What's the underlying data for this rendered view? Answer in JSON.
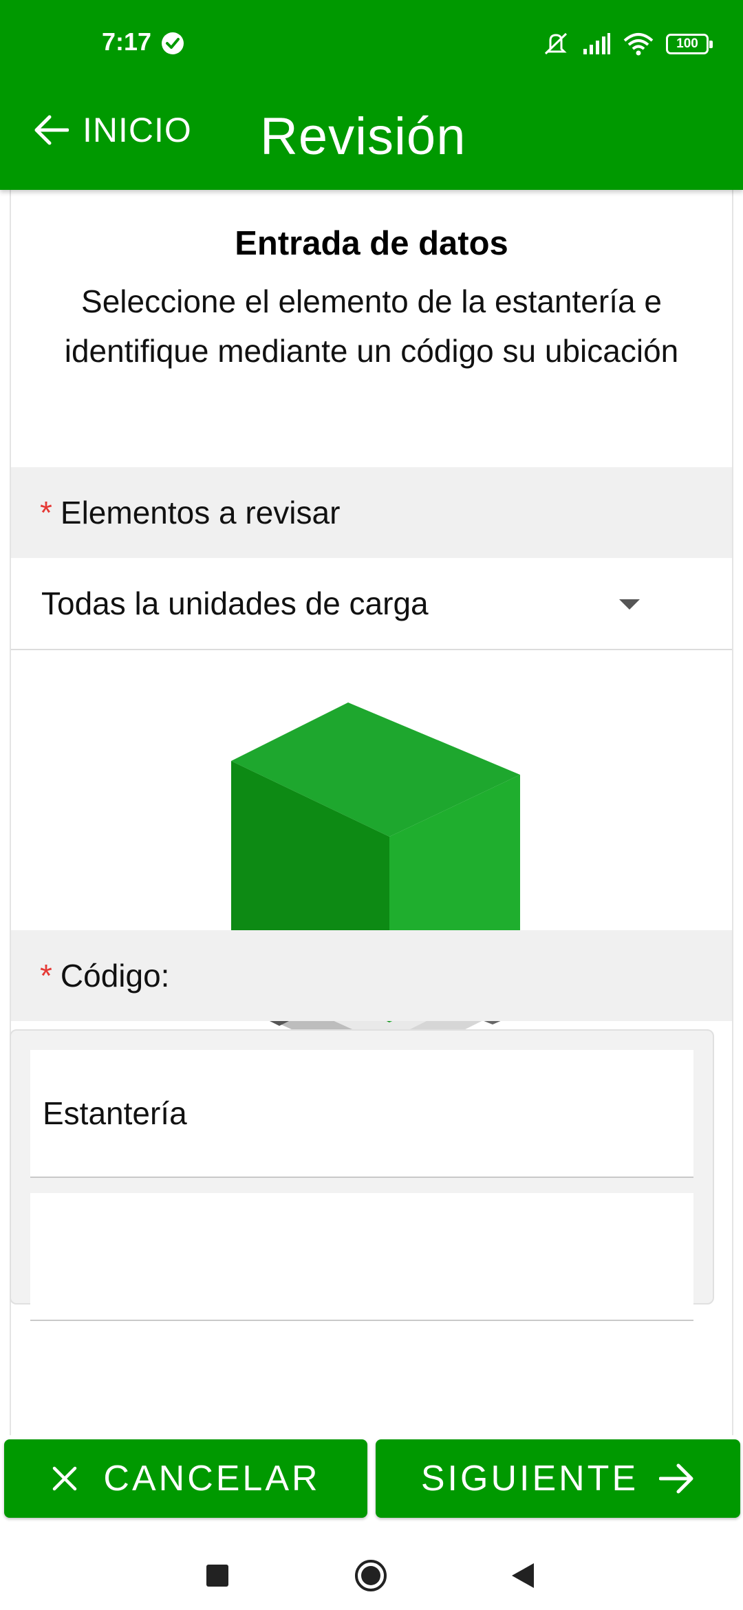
{
  "status_bar": {
    "time": "7:17",
    "battery": "100",
    "icons": [
      "check-circle-icon",
      "vibrate-off-icon",
      "signal-icon",
      "wifi-icon",
      "battery-icon"
    ]
  },
  "app_bar": {
    "back_label": "INICIO",
    "title": "Revisión",
    "color": "#009900"
  },
  "form": {
    "heading": "Entrada de datos",
    "description": "Seleccione el elemento de la estantería e identifique mediante un código su ubicación",
    "required_marker": "*",
    "elements_label": "Elementos a revisar",
    "elements_selected": "Todas la unidades de carga",
    "code_label": "Código:",
    "fields": [
      "Estantería",
      ""
    ]
  },
  "actions": {
    "cancel_label": "CANCELAR",
    "next_label": "SIGUIENTE"
  }
}
